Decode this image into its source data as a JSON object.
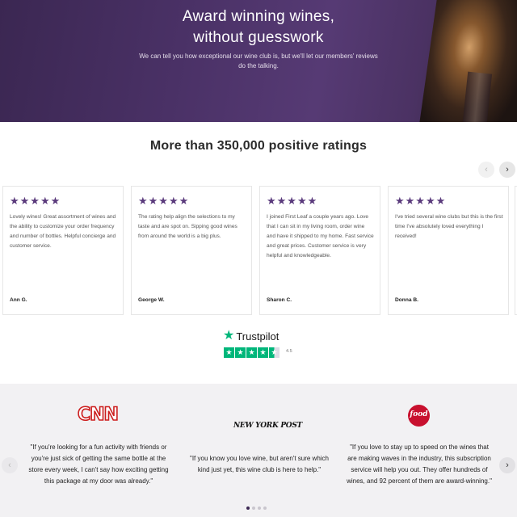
{
  "hero": {
    "title_line1": "Award winning wines,",
    "title_line2": "without guesswork",
    "subtitle": "We can tell you how exceptional our wine club is, but we'll let our members' reviews do the talking."
  },
  "ratings": {
    "title": "More than 350,000 positive ratings",
    "prev_icon": "‹",
    "next_icon": "›",
    "reviews": [
      {
        "stars": "★★★★★",
        "text": "Lovely wines! Great assortment of wines and the ability to customize your order frequency and number of bottles. Helpful concierge and customer service.",
        "author": "Ann G."
      },
      {
        "stars": "★★★★★",
        "text": "The rating help align the selections to my taste and are spot on. Sipping good wines from around the world is a big plus.",
        "author": "George W."
      },
      {
        "stars": "★★★★★",
        "text": "I joined First Leaf a couple years ago. Love that I can sit in my living room, order wine and have it shipped to my home. Fast service and great prices. Customer service is very helpful and knowledgeable.",
        "author": "Sharon C."
      },
      {
        "stars": "★★★★★",
        "text": "I've tried several wine clubs but this is the first time I've absolutely loved everything I received!",
        "author": "Donna B."
      }
    ]
  },
  "trustpilot": {
    "logo_star": "★",
    "name": "Trustpilot",
    "score": "4.5",
    "box_star": "★"
  },
  "press": {
    "prev_icon": "‹",
    "next_icon": "›",
    "logos": {
      "cnn": "CNN",
      "nypost": "NEW YORK POST",
      "food": "food"
    },
    "quotes": [
      "\"If you're looking for a fun activity with friends or you're just sick of getting the same bottle at the store every week, I can't say how exciting getting this package at my door was already.\"",
      "\"If you know you love wine, but aren't sure which kind just yet, this wine club is here to help.\"",
      "\"If you love to stay up to speed on the wines that are making waves in the industry, this subscription service will help you out. They offer hundreds of wines, and 92 percent of them are award-winning.\""
    ]
  },
  "colors": {
    "accent": "#5a3a7c",
    "trustpilot_green": "#00b67a",
    "cnn_red": "#cc1e1e",
    "food_red": "#c8102e"
  }
}
